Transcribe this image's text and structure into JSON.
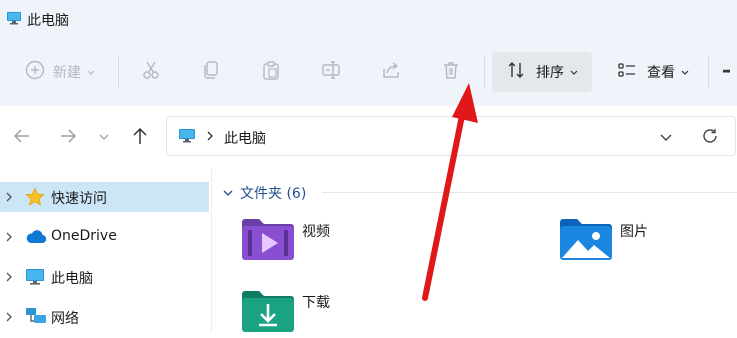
{
  "window": {
    "title": "此电脑"
  },
  "toolbar": {
    "new_label": "新建",
    "sort_label": "排序",
    "view_label": "查看",
    "more_label": "···"
  },
  "address": {
    "location": "此电脑"
  },
  "sidebar": {
    "items": [
      {
        "label": "快速访问",
        "icon": "star-icon",
        "selected": true
      },
      {
        "label": "OneDrive",
        "icon": "cloud-icon",
        "selected": false
      },
      {
        "label": "此电脑",
        "icon": "monitor-icon",
        "selected": false
      },
      {
        "label": "网络",
        "icon": "network-icon",
        "selected": false
      }
    ]
  },
  "main": {
    "group_label": "文件夹 (6)",
    "folders": [
      {
        "label": "视频",
        "icon": "videos-folder-icon"
      },
      {
        "label": "图片",
        "icon": "pictures-folder-icon"
      },
      {
        "label": "下载",
        "icon": "downloads-folder-icon"
      }
    ]
  },
  "colors": {
    "accent": "#0067c0",
    "annotation_arrow": "#e01818",
    "selection": "#cde6f7",
    "chrome": "#eef4f9"
  }
}
